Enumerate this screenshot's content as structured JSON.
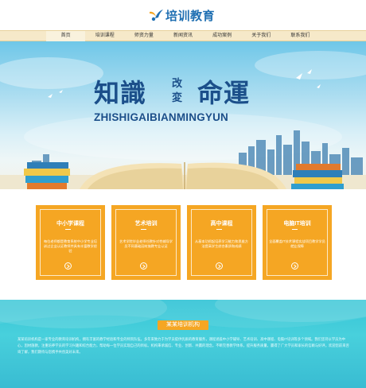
{
  "header": {
    "logo_text": "培训教育",
    "logo_icon": "bird-logo-icon"
  },
  "nav": {
    "items": [
      {
        "label": "首页"
      },
      {
        "label": "培训课程"
      },
      {
        "label": "师资力量"
      },
      {
        "label": "新闻资讯"
      },
      {
        "label": "成功案例"
      },
      {
        "label": "关于我们"
      },
      {
        "label": "联系我们"
      }
    ],
    "active_index": 0
  },
  "banner": {
    "slogan_left": "知識",
    "slogan_small_top": "改",
    "slogan_small_bottom": "変",
    "slogan_right": "命運",
    "pinyin": "ZHISHIGAIBIANMINGYUN"
  },
  "cards": [
    {
      "title": "中小学课程",
      "desc": "每位老师都是教育系统中小学专业培训过企业认证教师并具有丰富教学经验",
      "arrow_icon": "arrow-right-circle-icon"
    },
    {
      "title": "艺术培训",
      "desc": "艺术学院毕业老师任教针对性辅导学员不同基础因材施教专业认证",
      "arrow_icon": "arrow-right-circle-icon"
    },
    {
      "title": "高中课程",
      "desc": "从基本功抓起培养学习能力和思维方法提高学生综合素质和成绩",
      "arrow_icon": "arrow-right-circle-icon"
    },
    {
      "title": "电脑IT培训",
      "desc": "全面覆盖IT技术课程实战项目教学学员就业保障",
      "arrow_icon": "arrow-right-circle-icon"
    }
  ],
  "about": {
    "title": "某某培训机构",
    "text": "某某培训机构是一家专业的教育培训机构，拥有丰富的教学经验和专业的师资队伍。多年来致力于为学员提供优质的教育服务，课程涵盖中小学辅导、艺术培训、高中课程、电脑IT培训等多个领域。我们坚持以学员为中心，因材施教，注重培养学员的学习兴趣和综合能力，帮助每一位学员实现自己的目标。机构秉承诚信、专业、创新、共赢的理念，不断完善教学体系，提升服务质量，赢得了广大学员和家长的信赖与好评。欢迎您前来咨询了解，我们期待与您携手共创美好未来。"
  },
  "colors": {
    "accent": "#f5a623",
    "brand_blue": "#1b4f8a",
    "nav_bg": "#f6e9c9",
    "footer_teal": "#3ec8d8"
  }
}
